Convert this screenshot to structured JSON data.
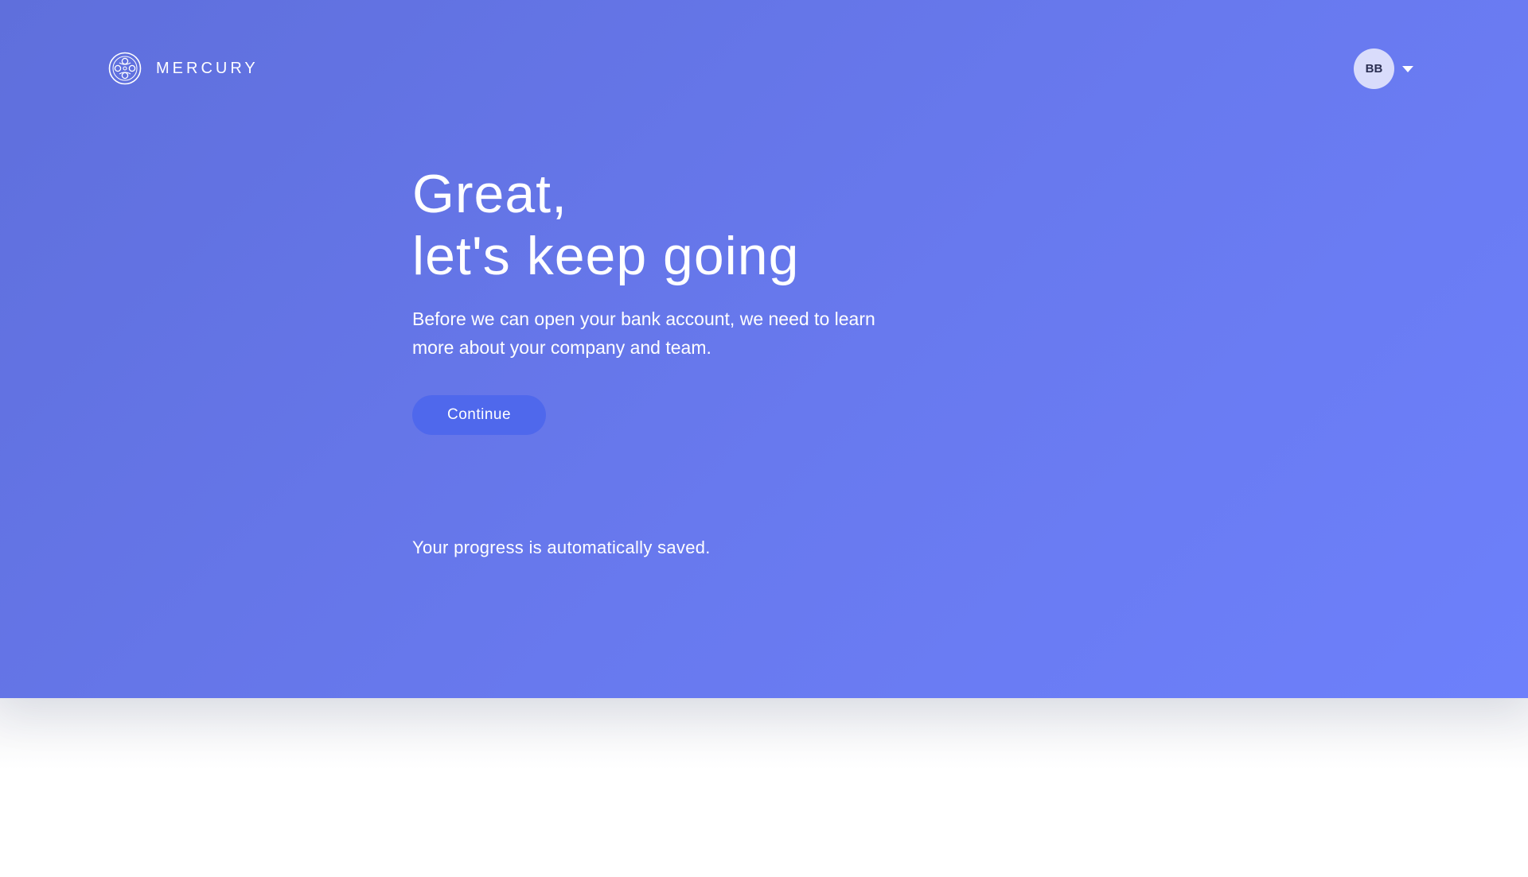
{
  "brand": {
    "name": "MERCURY",
    "logo_icon": "mercury-logo-icon"
  },
  "user": {
    "initials": "BB",
    "menu_icon": "caret-down-icon"
  },
  "main": {
    "headline_line1": "Great,",
    "headline_line2": "let's keep going",
    "description": "Before we can open your bank account, we need to learn more about your company and team.",
    "continue_label": "Continue",
    "progress_note": "Your progress is automatically saved."
  },
  "colors": {
    "hero_gradient_start": "#5f6fdc",
    "hero_gradient_end": "#6d80fb",
    "button": "#4f68ec",
    "avatar_bg": "#d9dcfb"
  }
}
